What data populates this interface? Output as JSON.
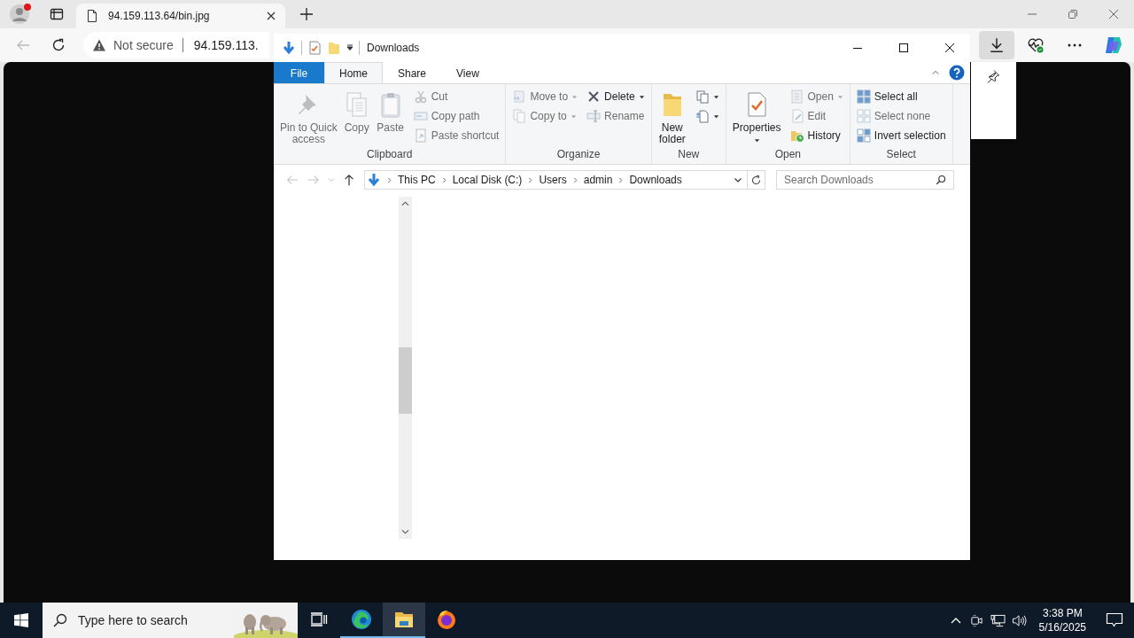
{
  "browser": {
    "tabs": [
      {
        "title": "94.159.113.64/bin.jpg",
        "selected": true
      }
    ],
    "security_label": "Not secure",
    "url": "94.159.113."
  },
  "explorer": {
    "title": "Downloads",
    "ribbon_tabs": [
      {
        "label": "File",
        "kind": "file",
        "selected": false
      },
      {
        "label": "Home",
        "kind": "tab",
        "selected": true
      },
      {
        "label": "Share",
        "kind": "tab",
        "selected": false
      },
      {
        "label": "View",
        "kind": "tab",
        "selected": false
      }
    ],
    "ribbon_groups": [
      {
        "label": "Clipboard",
        "columns": [
          {
            "kind": "large",
            "items": [
              {
                "label": "Pin to Quick\naccess",
                "dropdown": false,
                "disabled": true
              },
              {
                "label": "Copy",
                "dropdown": false,
                "disabled": true
              },
              {
                "label": "Paste",
                "dropdown": false,
                "disabled": true
              }
            ]
          },
          {
            "kind": "small",
            "items": [
              {
                "label": "Cut",
                "dropdown": false,
                "disabled": true
              },
              {
                "label": "Copy path",
                "dropdown": false,
                "disabled": true
              },
              {
                "label": "Paste shortcut",
                "dropdown": false,
                "disabled": true
              }
            ]
          }
        ]
      },
      {
        "label": "Organize",
        "columns": [
          {
            "kind": "small",
            "items": [
              {
                "label": "Move to",
                "dropdown": true,
                "disabled": true
              },
              {
                "label": "Copy to",
                "dropdown": true,
                "disabled": true
              }
            ]
          },
          {
            "kind": "small",
            "items": [
              {
                "label": "Delete",
                "dropdown": true,
                "disabled": false
              },
              {
                "label": "Rename",
                "dropdown": false,
                "disabled": true
              }
            ]
          }
        ]
      },
      {
        "label": "New",
        "columns": [
          {
            "kind": "large",
            "items": [
              {
                "label": "New\nfolder",
                "dropdown": false,
                "disabled": false
              }
            ]
          },
          {
            "kind": "small",
            "items": [
              {
                "dropdown": true,
                "disabled": false
              },
              {
                "dropdown": true,
                "disabled": false
              }
            ]
          }
        ]
      },
      {
        "label": "Open",
        "columns": [
          {
            "kind": "large",
            "items": [
              {
                "label": "Properties",
                "dropdown": true,
                "disabled": false
              }
            ]
          },
          {
            "kind": "small",
            "items": [
              {
                "label": "Open",
                "dropdown": true,
                "disabled": true
              },
              {
                "label": "Edit",
                "dropdown": false,
                "disabled": true
              },
              {
                "label": "History",
                "dropdown": false,
                "disabled": false
              }
            ]
          }
        ]
      },
      {
        "label": "Select",
        "columns": [
          {
            "kind": "small",
            "items": [
              {
                "label": "Select all",
                "dropdown": false,
                "disabled": false
              },
              {
                "label": "Select none",
                "dropdown": false,
                "disabled": true
              },
              {
                "label": "Invert selection",
                "dropdown": false,
                "disabled": false
              }
            ]
          }
        ]
      }
    ],
    "breadcrumbs": [
      "This PC",
      "Local Disk (C:)",
      "Users",
      "admin",
      "Downloads"
    ],
    "search": {
      "placeholder": "Search Downloads"
    }
  },
  "taskbar": {
    "search": {
      "placeholder": "Type here to search"
    },
    "apps": [
      {
        "kind": "edge",
        "running": true,
        "selected": false
      },
      {
        "kind": "explorer",
        "running": true,
        "selected": true
      },
      {
        "kind": "firefox",
        "running": false,
        "selected": false
      }
    ],
    "time": "3:38 PM",
    "date": "5/16/2025"
  }
}
